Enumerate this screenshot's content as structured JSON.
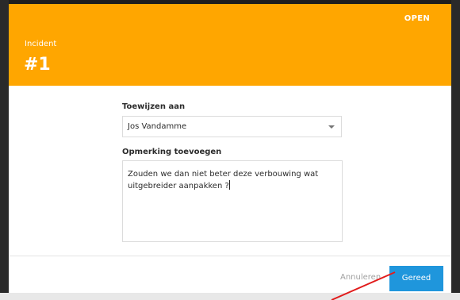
{
  "incident": {
    "status": "OPEN",
    "type_label": "Incident",
    "number": "#1"
  },
  "form": {
    "assign_label": "Toewijzen aan",
    "assignee": "Jos Vandamme",
    "comment_label": "Opmerking toevoegen",
    "comment_text": "Zouden we dan niet beter deze verbouwing wat uitgebreider aanpakken ?"
  },
  "actions": {
    "cancel_label": "Annuleren",
    "done_label": "Gereed"
  },
  "colors": {
    "header": "#ffa600",
    "primary_button": "#1f96dc",
    "annotation": "#e11c1c"
  }
}
